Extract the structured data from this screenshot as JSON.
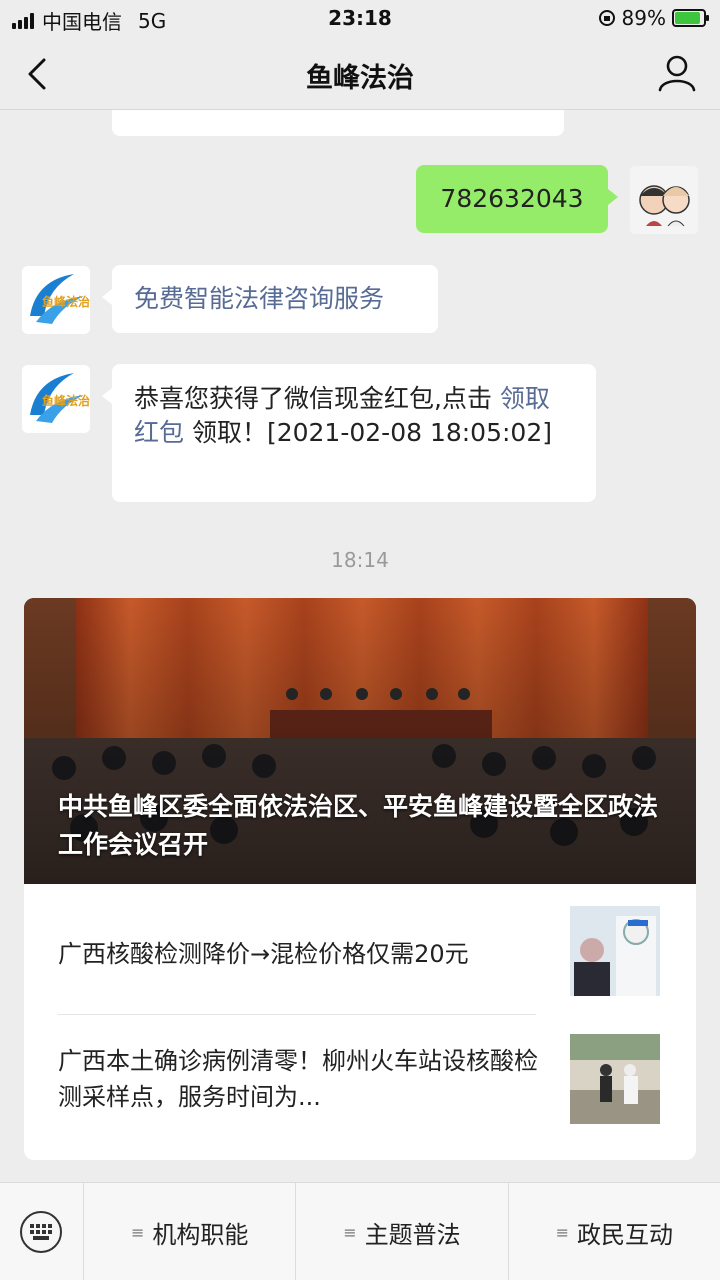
{
  "status": {
    "carrier": "中国电信",
    "network": "5G",
    "time": "23:18",
    "battery_text": "89%",
    "battery_level": 0.89
  },
  "nav": {
    "title": "鱼峰法治"
  },
  "messages": {
    "user_number": "782632043",
    "service_link": "免费智能法律咨询服务",
    "redpacket_prefix": "恭喜您获得了微信现金红包,点击 ",
    "redpacket_link": "领取红包",
    "redpacket_suffix": " 领取！[2021-02-08 18:05:02]",
    "bot_avatar_text": "鱼峰法治"
  },
  "timestamp": "18:14",
  "articles": {
    "hero_title": "中共鱼峰区委全面依法治区、平安鱼峰建设暨全区政法工作会议召开",
    "items": [
      {
        "title": "广西核酸检测降价→混检价格仅需20元"
      },
      {
        "title": "广西本土确诊病例清零！柳州火车站设核酸检测采样点，服务时间为..."
      }
    ]
  },
  "menu": {
    "items": [
      {
        "label": "机构职能"
      },
      {
        "label": "主题普法"
      },
      {
        "label": "政民互动"
      }
    ]
  },
  "colors": {
    "background": "#ededed",
    "green_bubble": "#95ec69",
    "link": "#576b95"
  }
}
